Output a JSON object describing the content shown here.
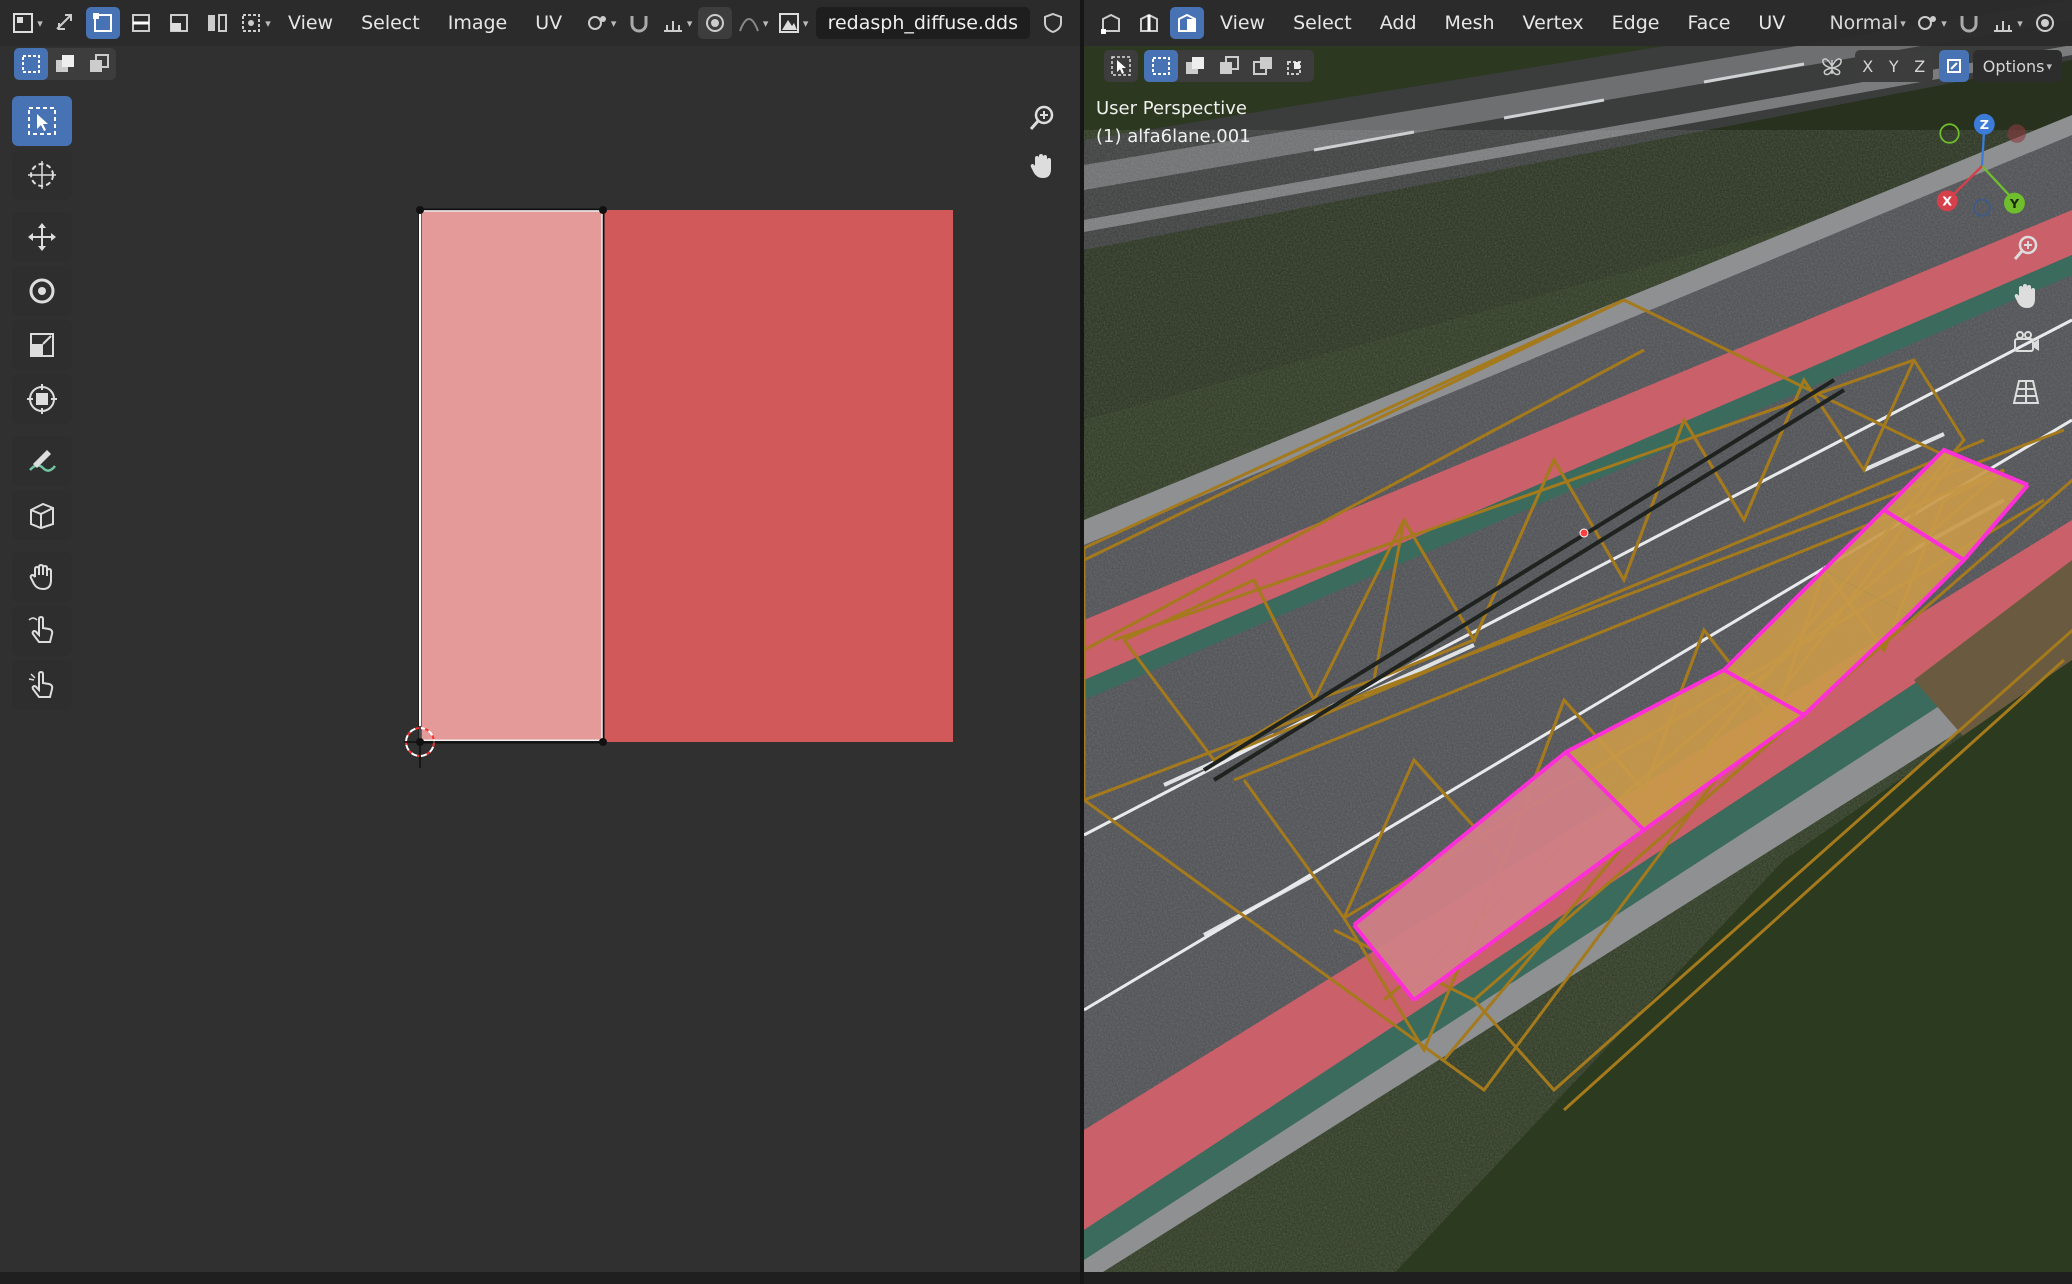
{
  "uv_editor": {
    "menus": [
      "View",
      "Select",
      "Image",
      "UV"
    ],
    "image_name": "redasph_diffuse.dds",
    "tools": [
      {
        "name": "select-box-tool",
        "icon": "select-box-icon",
        "active": true
      },
      {
        "name": "cursor-tool",
        "icon": "cursor-icon"
      },
      {
        "name": "move-tool",
        "icon": "move-icon"
      },
      {
        "name": "rotate-tool",
        "icon": "rotate-icon"
      },
      {
        "name": "scale-tool",
        "icon": "scale-icon"
      },
      {
        "name": "transform-tool",
        "icon": "transform-icon"
      },
      {
        "name": "annotate-tool",
        "icon": "annotate-icon"
      },
      {
        "name": "rip-tool",
        "icon": "rip-icon"
      },
      {
        "name": "grab-tool",
        "icon": "grab-icon"
      },
      {
        "name": "relax-tool",
        "icon": "relax-icon"
      },
      {
        "name": "pinch-tool",
        "icon": "pinch-icon"
      }
    ],
    "colors": {
      "texture_light": "#e59a9a",
      "texture_red": "#df5f5f",
      "background": "#303030"
    }
  },
  "viewport": {
    "menus": [
      "View",
      "Select",
      "Add",
      "Mesh",
      "Vertex",
      "Edge",
      "Face",
      "UV"
    ],
    "orientation": "Normal",
    "axes": [
      "X",
      "Y",
      "Z"
    ],
    "options_label": "Options",
    "perspective_label": "User Perspective",
    "object_label": "(1) alfa6lane.001",
    "gizmo_axes": {
      "x": "X",
      "y": "Y",
      "z": "Z"
    },
    "colors": {
      "wire": "#a47a1c",
      "selected": "#ff3fd6",
      "road": "#4e4f53",
      "bike_lane": "#c9606a",
      "green_strip": "#3b6b5c"
    }
  }
}
